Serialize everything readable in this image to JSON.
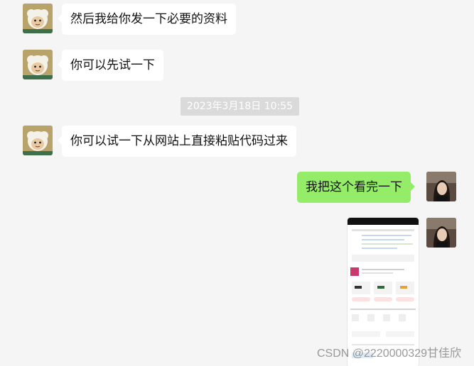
{
  "messages": [
    {
      "text": "然后我给你发一下必要的资料"
    },
    {
      "text": "你可以先试一下"
    },
    {
      "text": "你可以试一下从网站上直接粘贴代码过来"
    },
    {
      "text": "我把这个看完一下"
    }
  ],
  "timestamp": "2023年3月18日 10:55",
  "watermark": "CSDN @2220000329甘佳欣",
  "colors": {
    "background": "#f5f5f5",
    "incoming_bubble": "#ffffff",
    "outgoing_bubble": "#95ec69"
  },
  "icons": {
    "contact_avatar": "cartoon-sheep-avatar",
    "self_avatar": "profile-photo-avatar"
  }
}
